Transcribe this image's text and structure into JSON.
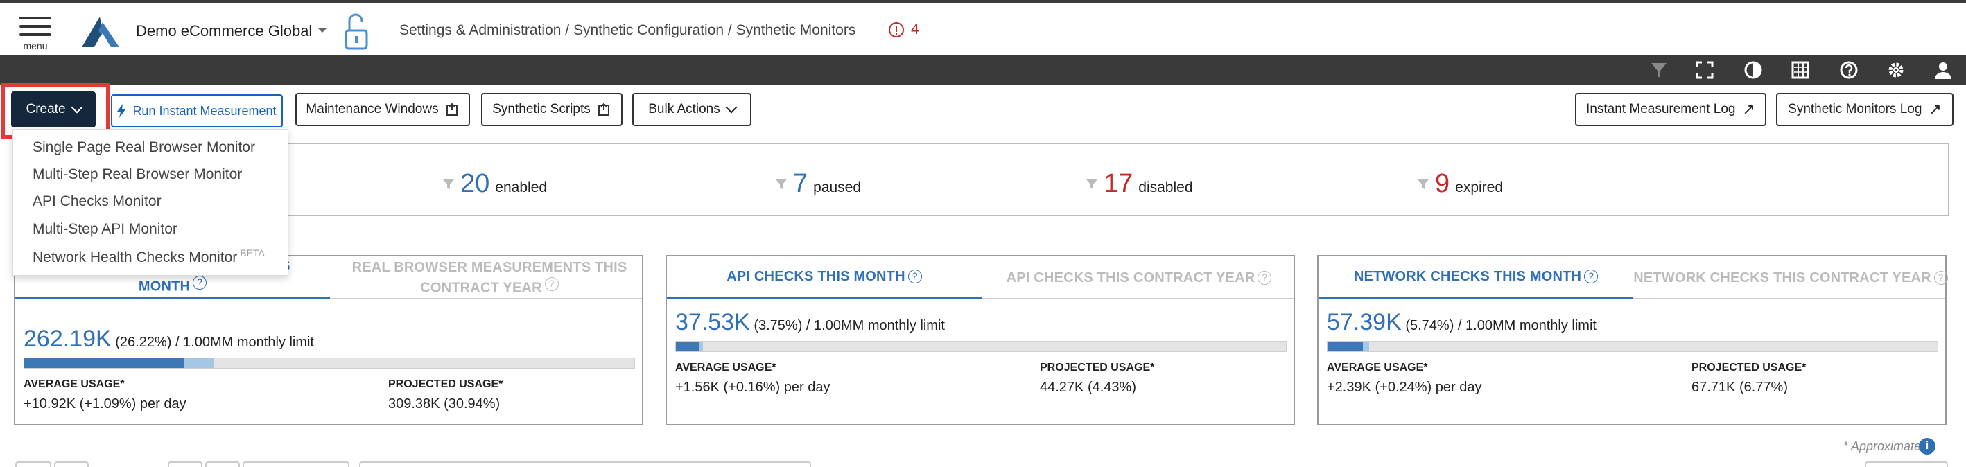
{
  "header": {
    "menu_label": "menu",
    "app_title": "Demo eCommerce Global",
    "breadcrumb": "Settings & Administration / Synthetic Configuration / Synthetic Monitors",
    "alert_count": "4",
    "alert_color": "#c62828"
  },
  "darkbar_icons": [
    "filter-icon",
    "fullscreen-icon",
    "contrast-icon",
    "columns-icon",
    "help-icon",
    "gear-icon",
    "user-icon"
  ],
  "toolbar": {
    "create_label": "Create",
    "run_label": "Run Instant Measurement",
    "maintenance_label": "Maintenance Windows",
    "scripts_label": "Synthetic Scripts",
    "bulk_label": "Bulk Actions",
    "instant_log_label": "Instant Measurement Log",
    "monitors_log_label": "Synthetic Monitors Log"
  },
  "create_menu": {
    "items": [
      "Single Page Real Browser Monitor",
      "Multi-Step Real Browser Monitor",
      "API Checks Monitor",
      "Multi-Step API Monitor",
      "Network Health Checks Monitor"
    ],
    "beta_tag": "BETA"
  },
  "summary": {
    "enabled": {
      "count": "20",
      "label": "enabled"
    },
    "paused": {
      "count": "7",
      "label": "paused"
    },
    "disabled": {
      "count": "17",
      "label": "disabled"
    },
    "expired": {
      "count": "9",
      "label": "expired"
    },
    "colors": {
      "blue": "#2f6fb5",
      "red": "#c62828"
    }
  },
  "panels": [
    {
      "tab_active_line1": "IS",
      "tab_active_line2": "MONTH",
      "tab_inactive_line1": "REAL BROWSER MEASUREMENTS THIS",
      "tab_inactive_line2": "CONTRACT YEAR",
      "value": "262.19K",
      "detail": "(26.22%) / 1.00MM monthly limit",
      "usage_fraction": 0.2622,
      "projected_fraction": 0.3094,
      "avg_label": "AVERAGE USAGE*",
      "avg_value": "+10.92K (+1.09%) per day",
      "proj_label": "PROJECTED USAGE*",
      "proj_value": "309.38K (30.94%)"
    },
    {
      "tab_active": "API CHECKS THIS MONTH",
      "tab_inactive": "API CHECKS THIS CONTRACT YEAR",
      "value": "37.53K",
      "detail": "(3.75%) / 1.00MM monthly limit",
      "usage_fraction": 0.0375,
      "projected_fraction": 0.0443,
      "avg_label": "AVERAGE USAGE*",
      "avg_value": "+1.56K (+0.16%) per day",
      "proj_label": "PROJECTED USAGE*",
      "proj_value": "44.27K (4.43%)"
    },
    {
      "tab_active": "NETWORK CHECKS THIS MONTH",
      "tab_inactive": "NETWORK CHECKS THIS CONTRACT YEAR",
      "value": "57.39K",
      "detail": "(5.74%) / 1.00MM monthly limit",
      "usage_fraction": 0.0574,
      "projected_fraction": 0.0677,
      "avg_label": "AVERAGE USAGE*",
      "avg_value": "+2.39K (+0.24%) per day",
      "proj_label": "PROJECTED USAGE*",
      "proj_value": "67.71K (6.77%)"
    }
  ],
  "footnote": "* Approximate.",
  "footnote_icon": "info-icon"
}
